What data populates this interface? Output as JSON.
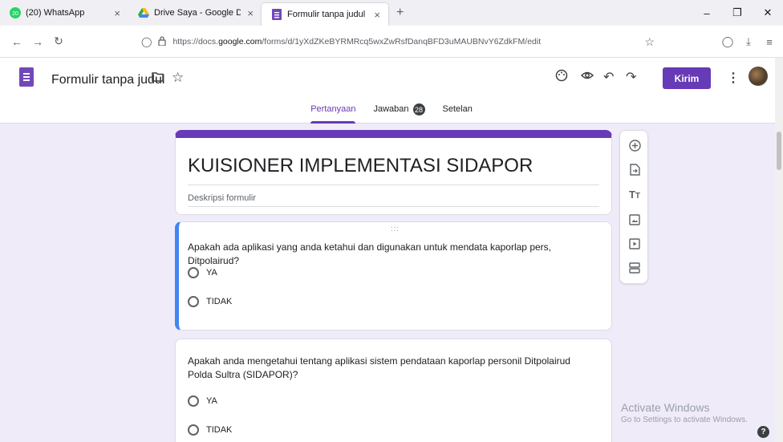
{
  "browser": {
    "tabs": [
      {
        "title": "(20) WhatsApp",
        "badge": "20"
      },
      {
        "title": "Drive Saya - Google Drive"
      },
      {
        "title": "Formulir tanpa judul - Google F"
      }
    ],
    "new_tab": "+",
    "close_symbol": "×",
    "url_prefix": "https://docs.",
    "url_domain": "google.com",
    "url_suffix": "/forms/d/1yXdZKeBYRMRcq5wxZwRsfDanqBFD3uMAUBNvY6ZdkFM/edit"
  },
  "header": {
    "form_title": "Formulir tanpa judul",
    "send_label": "Kirim",
    "tabs": [
      {
        "label": "Pertanyaan"
      },
      {
        "label": "Jawaban",
        "count": "28"
      },
      {
        "label": "Setelan"
      }
    ]
  },
  "form": {
    "title": "KUISIONER IMPLEMENTASI SIDAPOR",
    "description_placeholder": "Deskripsi formulir",
    "questions": [
      {
        "text": "Apakah ada aplikasi yang anda ketahui dan digunakan untuk mendata kaporlap pers, Ditpolairud?",
        "options": [
          "YA",
          "TIDAK"
        ]
      },
      {
        "text": "Apakah anda mengetahui tentang aplikasi sistem pendataan kaporlap personil Ditpolairud Polda Sultra (SIDAPOR)?",
        "options": [
          "YA",
          "TIDAK"
        ]
      }
    ]
  },
  "watermark": {
    "line1": "Activate Windows",
    "line2": "Go to Settings to activate Windows."
  },
  "colors": {
    "accent": "#673ab7",
    "active_question": "#4285f4",
    "background": "#f0ebf8"
  }
}
